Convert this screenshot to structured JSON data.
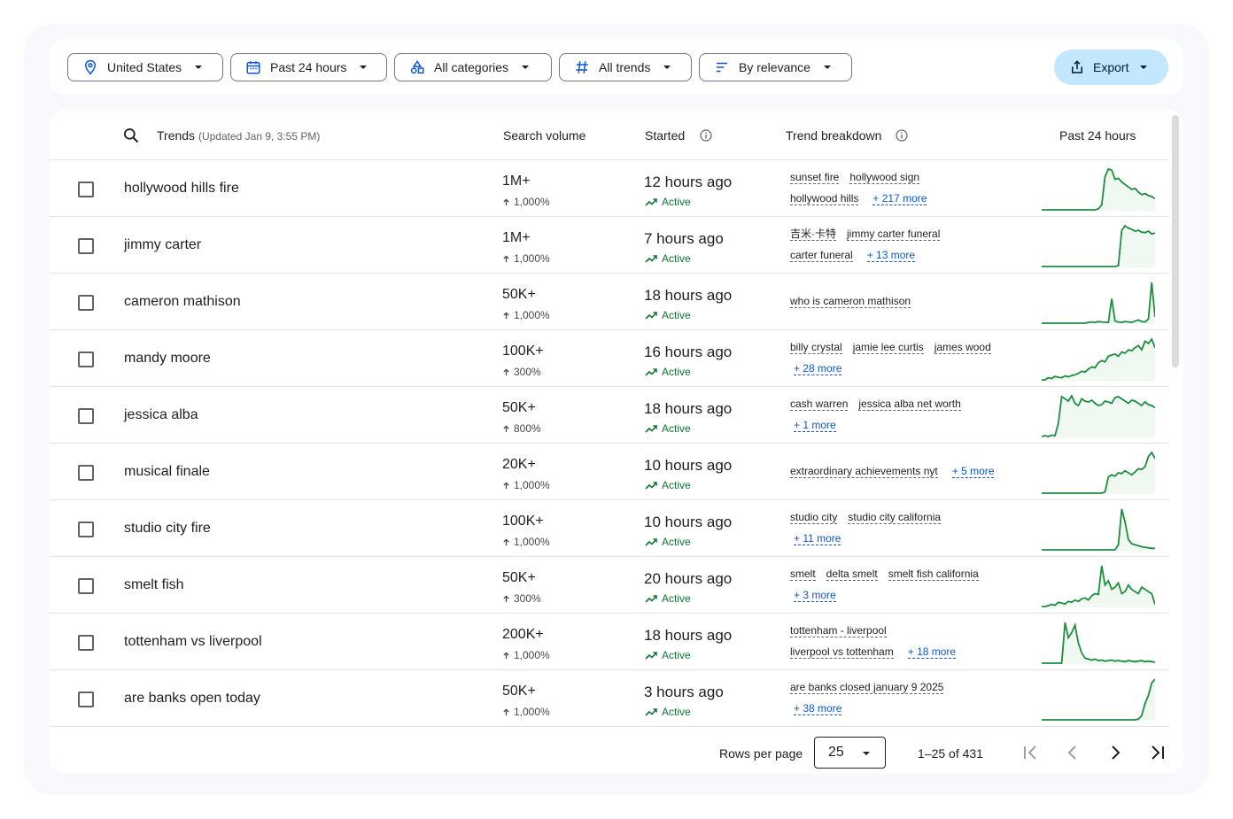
{
  "filters": {
    "location": "United States",
    "time": "Past 24 hours",
    "category": "All categories",
    "trend_type": "All trends",
    "sort": "By relevance",
    "export": "Export"
  },
  "columns": {
    "trends": "Trends",
    "updated": "(Updated Jan 9, 3:55 PM)",
    "search_volume": "Search volume",
    "started": "Started",
    "breakdown": "Trend breakdown",
    "past": "Past 24 hours"
  },
  "rows": [
    {
      "term": "hollywood hills fire",
      "volume": "1M+",
      "pct": "1,000%",
      "started": "12 hours ago",
      "status": "Active",
      "line1": [
        "sunset fire",
        "hollywood sign"
      ],
      "line2": [
        "hollywood hills"
      ],
      "more": "+ 217 more",
      "more_line": 2,
      "spark": [
        0,
        0,
        0,
        0,
        0,
        0,
        0,
        0,
        0,
        0,
        0,
        0,
        0,
        0,
        0,
        0,
        0,
        2,
        10,
        65,
        80,
        78,
        60,
        62,
        55,
        50,
        45,
        40,
        42,
        35,
        30,
        32,
        28,
        26,
        22
      ]
    },
    {
      "term": "jimmy carter",
      "volume": "1M+",
      "pct": "1,000%",
      "started": "7 hours ago",
      "status": "Active",
      "line1": [
        "吉米·卡特",
        "jimmy carter funeral"
      ],
      "line2": [
        "carter funeral"
      ],
      "more": "+ 13 more",
      "more_line": 2,
      "spark": [
        0,
        0,
        0,
        0,
        0,
        0,
        0,
        0,
        0,
        0,
        0,
        0,
        0,
        0,
        0,
        0,
        0,
        0,
        0,
        0,
        0,
        0,
        0,
        2,
        80,
        90,
        85,
        82,
        78,
        80,
        76,
        75,
        78,
        72,
        74
      ]
    },
    {
      "term": "cameron mathison",
      "volume": "50K+",
      "pct": "1,000%",
      "started": "18 hours ago",
      "status": "Active",
      "line1": [
        "who is cameron mathison"
      ],
      "line2": [],
      "more": "",
      "more_line": 0,
      "spark": [
        0,
        0,
        0,
        0,
        0,
        0,
        0,
        0,
        0,
        0,
        0,
        0,
        0,
        0,
        2,
        3,
        2,
        4,
        3,
        2,
        2,
        60,
        5,
        3,
        2,
        4,
        3,
        2,
        5,
        8,
        4,
        3,
        10,
        100,
        15
      ]
    },
    {
      "term": "mandy moore",
      "volume": "100K+",
      "pct": "300%",
      "started": "16 hours ago",
      "status": "Active",
      "line1": [
        "billy crystal",
        "jamie lee curtis",
        "james wood"
      ],
      "line2": [],
      "more": "+ 28 more",
      "more_line": 2,
      "spark": [
        0,
        0,
        5,
        3,
        8,
        6,
        5,
        9,
        7,
        10,
        12,
        15,
        20,
        18,
        25,
        30,
        28,
        40,
        45,
        42,
        55,
        58,
        60,
        55,
        65,
        62,
        70,
        68,
        75,
        80,
        70,
        90,
        85,
        95,
        75
      ]
    },
    {
      "term": "jessica alba",
      "volume": "50K+",
      "pct": "800%",
      "started": "18 hours ago",
      "status": "Active",
      "line1": [
        "cash warren",
        "jessica alba net worth"
      ],
      "line2": [],
      "more": "+ 1 more",
      "more_line": 2,
      "spark": [
        0,
        2,
        0,
        3,
        2,
        30,
        90,
        85,
        80,
        92,
        75,
        70,
        85,
        80,
        78,
        82,
        75,
        70,
        72,
        80,
        78,
        75,
        88,
        90,
        85,
        80,
        75,
        82,
        80,
        75,
        70,
        78,
        72,
        70,
        65
      ]
    },
    {
      "term": "musical finale",
      "volume": "20K+",
      "pct": "1,000%",
      "started": "10 hours ago",
      "status": "Active",
      "line1": [
        "extraordinary achievements nyt"
      ],
      "line2": [],
      "more": "+ 5 more",
      "more_line": 1,
      "spark": [
        0,
        0,
        0,
        0,
        0,
        0,
        0,
        0,
        0,
        0,
        0,
        0,
        0,
        0,
        0,
        0,
        0,
        0,
        0,
        3,
        40,
        45,
        42,
        50,
        48,
        55,
        50,
        45,
        52,
        60,
        58,
        65,
        90,
        100,
        85
      ]
    },
    {
      "term": "studio city fire",
      "volume": "100K+",
      "pct": "1,000%",
      "started": "10 hours ago",
      "status": "Active",
      "line1": [
        "studio city",
        "studio city california"
      ],
      "line2": [],
      "more": "+ 11 more",
      "more_line": 2,
      "spark": [
        0,
        0,
        0,
        0,
        0,
        0,
        0,
        0,
        0,
        0,
        0,
        0,
        0,
        0,
        0,
        0,
        0,
        0,
        0,
        0,
        0,
        0,
        0,
        10,
        80,
        55,
        20,
        12,
        10,
        8,
        6,
        5,
        4,
        3,
        3
      ]
    },
    {
      "term": "smelt fish",
      "volume": "50K+",
      "pct": "300%",
      "started": "20 hours ago",
      "status": "Active",
      "line1": [
        "smelt",
        "delta smelt",
        "smelt fish california"
      ],
      "line2": [],
      "more": "+ 3 more",
      "more_line": 2,
      "spark": [
        0,
        0,
        2,
        5,
        3,
        10,
        8,
        6,
        12,
        10,
        15,
        12,
        18,
        20,
        15,
        25,
        30,
        28,
        95,
        50,
        60,
        40,
        45,
        55,
        30,
        35,
        50,
        40,
        35,
        30,
        45,
        40,
        35,
        30,
        5
      ]
    },
    {
      "term": "tottenham vs liverpool",
      "volume": "200K+",
      "pct": "1,000%",
      "started": "18 hours ago",
      "status": "Active",
      "line1": [
        "tottenham - liverpool"
      ],
      "line2": [
        "liverpool vs tottenham"
      ],
      "more": "+ 18 more",
      "more_line": 2,
      "spark": [
        0,
        0,
        0,
        0,
        0,
        0,
        0,
        80,
        50,
        60,
        75,
        40,
        20,
        10,
        8,
        6,
        8,
        5,
        6,
        4,
        5,
        6,
        4,
        5,
        4,
        3,
        5,
        4,
        3,
        4,
        5,
        3,
        4,
        3,
        2
      ]
    },
    {
      "term": "are banks open today",
      "volume": "50K+",
      "pct": "1,000%",
      "started": "3 hours ago",
      "status": "Active",
      "line1": [
        "are banks closed january 9 2025"
      ],
      "line2": [],
      "more": "+ 38 more",
      "more_line": 2,
      "spark": [
        0,
        0,
        0,
        0,
        0,
        0,
        0,
        0,
        0,
        0,
        0,
        0,
        0,
        0,
        0,
        0,
        0,
        0,
        0,
        0,
        0,
        0,
        0,
        0,
        0,
        0,
        0,
        0,
        0,
        2,
        10,
        40,
        60,
        90,
        100
      ]
    }
  ],
  "footer": {
    "rows_per_page_label": "Rows per page",
    "rows_per_page": "25",
    "range": "1–25 of 431"
  },
  "colors": {
    "accent": "#0b57d0",
    "trend_green": "#1e8e3e",
    "export_bg": "#c2e7ff"
  }
}
